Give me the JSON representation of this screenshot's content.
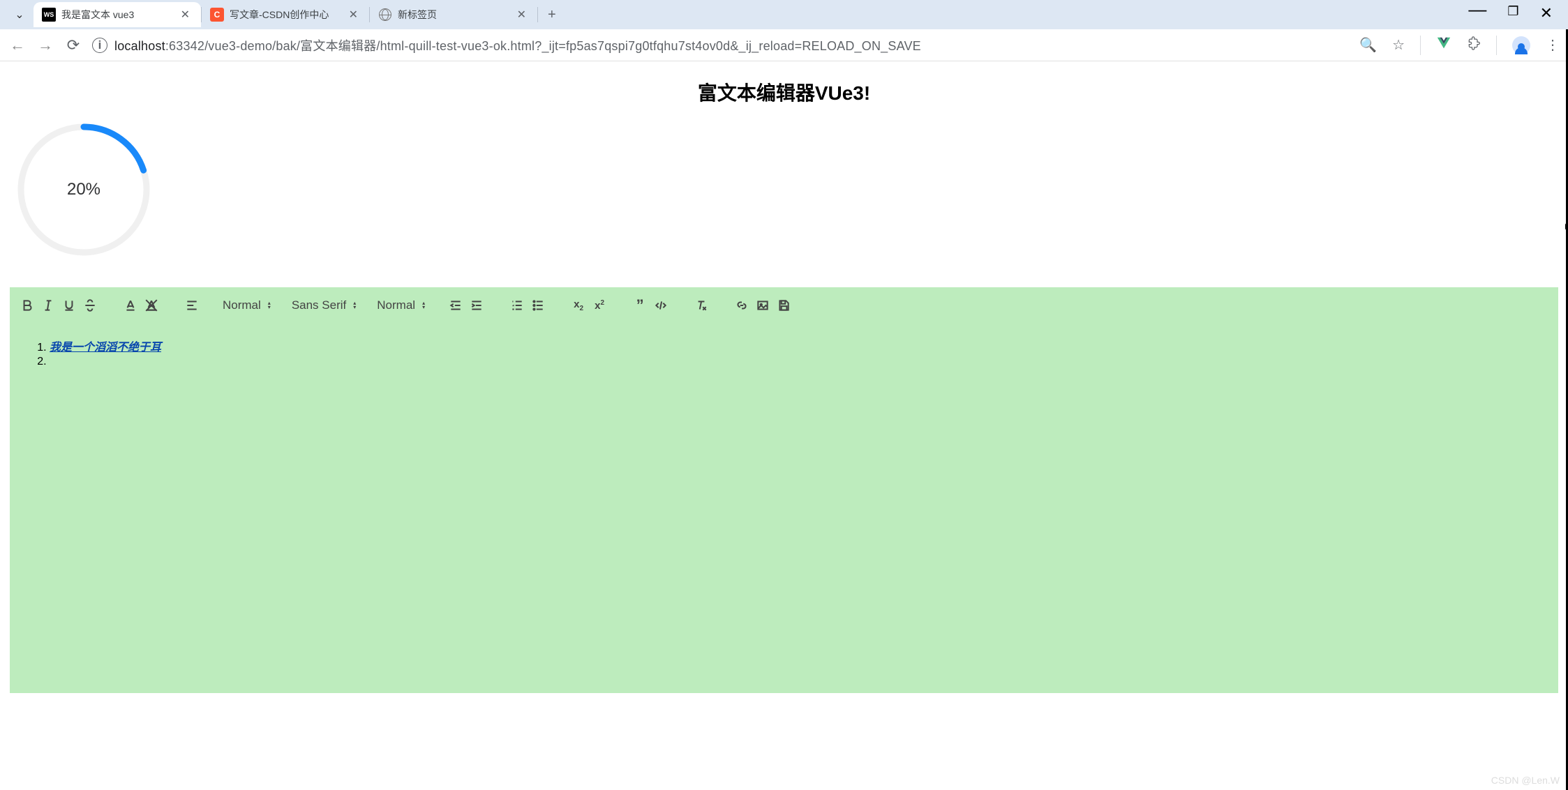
{
  "browser": {
    "tabs": [
      {
        "title": "我是富文本 vue3",
        "favicon": "ws"
      },
      {
        "title": "写文章-CSDN创作中心",
        "favicon": "csdn"
      },
      {
        "title": "新标签页",
        "favicon": "globe"
      }
    ],
    "url_host": "localhost",
    "url_path": ":63342/vue3-demo/bak/富文本编辑器/html-quill-test-vue3-ok.html?_ijt=fp5as7qspi7g0tfqhu7st4ov0d&_ij_reload=RELOAD_ON_SAVE"
  },
  "page": {
    "title": "富文本编辑器VUe3!",
    "progress_percent": 20,
    "progress_label": "20%"
  },
  "toolbar": {
    "header_picker": "Normal",
    "font_picker": "Sans Serif",
    "size_picker": "Normal"
  },
  "editor": {
    "list_items": [
      "我是一个滔滔不绝于耳",
      ""
    ]
  },
  "watermark": "CSDN @Len.W"
}
